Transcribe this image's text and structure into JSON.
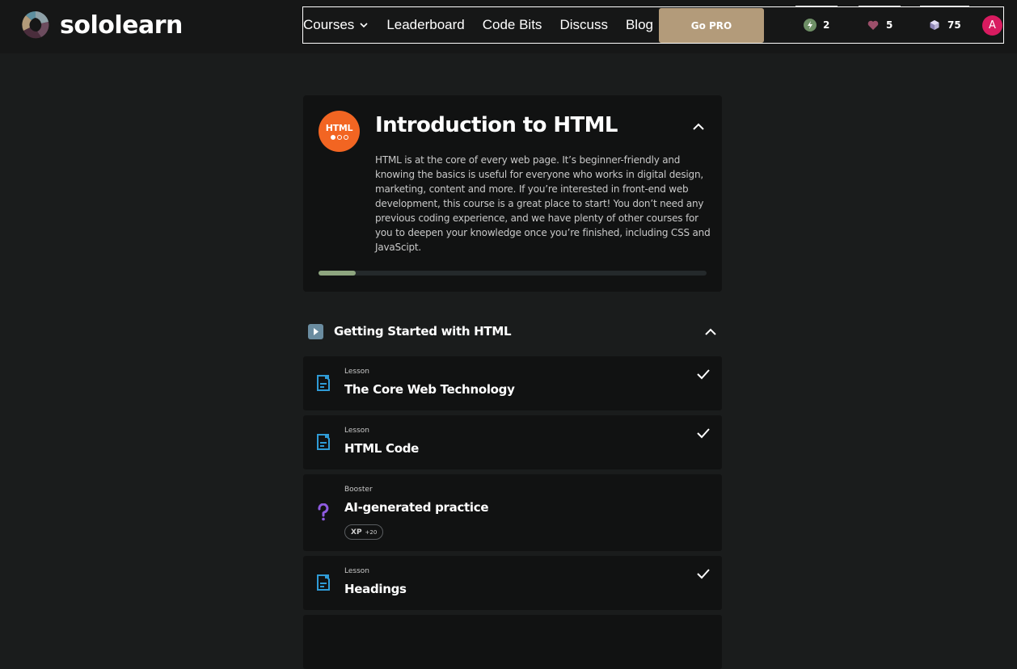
{
  "brand": {
    "name": "sololearn"
  },
  "nav": {
    "links": [
      "Courses",
      "Leaderboard",
      "Code Bits",
      "Discuss",
      "Blog"
    ],
    "go_pro": "Go PRO",
    "stats": {
      "streak": "2",
      "hearts": "5",
      "gems": "75"
    },
    "avatar_initial": "A"
  },
  "course": {
    "badge_text": "HTML",
    "title": "Introduction to HTML",
    "description": "HTML is at the core of every web page. It’s beginner-friendly and knowing the basics is useful for everyone who works in digital design, marketing, content and more. If you’re interested in front-end web development, this course is a great place to start! You don’t need any previous coding experience, and we have plenty of other courses for you to deepen your knowledge once you’re finished, including CSS and JavaScipt.",
    "progress_fraction": 0.095
  },
  "module": {
    "title": "Getting Started with HTML"
  },
  "lessons": [
    {
      "type": "Lesson",
      "title": "The Core Web Technology",
      "completed": true
    },
    {
      "type": "Lesson",
      "title": "HTML Code",
      "completed": true
    },
    {
      "type": "Booster",
      "title": "AI-generated practice",
      "completed": false,
      "xp_label": "XP",
      "xp_value": "+20"
    },
    {
      "type": "Lesson",
      "title": "Headings",
      "completed": true
    }
  ],
  "colors": {
    "background": "#1a1c1c",
    "card": "#111212",
    "go_pro": "#b39b7a",
    "html_badge": "#f26522",
    "progress": "#8ea57f",
    "lesson_icon": "#2f9bd6",
    "booster_icon": "#8f5be0",
    "avatar": "#d81b60"
  }
}
